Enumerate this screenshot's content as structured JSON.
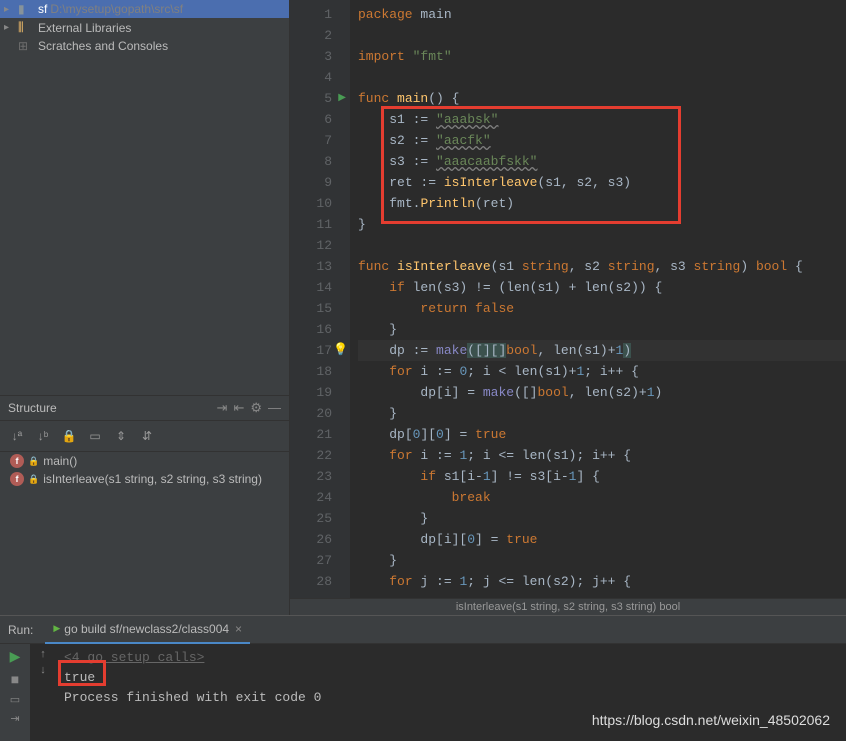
{
  "project": {
    "root_name": "sf",
    "root_path": "D:\\mysetup\\gopath\\src\\sf",
    "external_libs": "External Libraries",
    "scratches": "Scratches and Consoles"
  },
  "structure": {
    "title": "Structure",
    "items": [
      {
        "name": "main()"
      },
      {
        "name": "isInterleave(s1 string, s2 string, s3 string)"
      }
    ]
  },
  "gutter_lines": [
    "1",
    "2",
    "3",
    "4",
    "5",
    "6",
    "7",
    "8",
    "9",
    "10",
    "11",
    "12",
    "13",
    "14",
    "15",
    "16",
    "17",
    "18",
    "19",
    "20",
    "21",
    "22",
    "23",
    "24",
    "25",
    "26",
    "27",
    "28"
  ],
  "breadcrumb": "isInterleave(s1 string, s2 string, s3 string) bool",
  "code": {
    "l1_kw": "package",
    "l1_id": "main",
    "l3_kw": "import",
    "l3_str": "\"fmt\"",
    "l5_kw": "func",
    "l5_fn": "main",
    "l5_rest": "() {",
    "l6_v": "s1",
    "l6_op": " := ",
    "l6_str": "\"aaabsk\"",
    "l7_v": "s2",
    "l7_op": " := ",
    "l7_str": "\"aacfk\"",
    "l8_v": "s3",
    "l8_op": " := ",
    "l8_str": "\"aaacaabfskk\"",
    "l9_v": "ret",
    "l9_op": " := ",
    "l9_fn": "isInterleave",
    "l9_args": "(s1, s2, s3)",
    "l10_pre": "fmt.",
    "l10_fn": "Println",
    "l10_args": "(ret)",
    "l11": "}",
    "l13_kw": "func",
    "l13_fn": "isInterleave",
    "l13_sig": "(s1 ",
    "l13_t": "string",
    "l13_sig2": ", s2 ",
    "l13_sig3": ", s3 ",
    "l13_sig4": ") ",
    "l13_ret": "bool",
    "l13_end": " {",
    "l14_kw": "if",
    "l14_expr": " len(s3) != (len(s1) + len(s2)) {",
    "l15_kw": "return",
    "l15_v": " false",
    "l16": "}",
    "l17_v": "dp",
    "l17_op": " := ",
    "l17_fn": "make",
    "l17_args1": "([][]",
    "l17_bool": "bool",
    "l17_args2": ", len(s1)+",
    "l17_num": "1",
    "l17_args3": ")",
    "l18_kw": "for",
    "l18_a": " i := ",
    "l18_n0": "0",
    "l18_b": "; i < len(s1)+",
    "l18_n1": "1",
    "l18_c": "; i++ {",
    "l19_a": "dp[i] = ",
    "l19_fn": "make",
    "l19_b": "([]",
    "l19_bool": "bool",
    "l19_c": ", len(s2)+",
    "l19_n": "1",
    "l19_d": ")",
    "l20": "}",
    "l21_a": "dp[",
    "l21_n0": "0",
    "l21_b": "][",
    "l21_n1": "0",
    "l21_c": "] = ",
    "l21_v": "true",
    "l22_kw": "for",
    "l22_a": " i := ",
    "l22_n": "1",
    "l22_b": "; i <= len(s1); i++ {",
    "l23_kw": "if",
    "l23_a": " s1[i-",
    "l23_n1": "1",
    "l23_b": "] != s3[i-",
    "l23_n2": "1",
    "l23_c": "] {",
    "l24_kw": "break",
    "l25": "}",
    "l26_a": "dp[i][",
    "l26_n": "0",
    "l26_b": "] = ",
    "l26_v": "true",
    "l27": "}",
    "l28_kw": "for",
    "l28_a": " j := ",
    "l28_n": "1",
    "l28_b": "; j <= len(s2); j++ {"
  },
  "run": {
    "label": "Run:",
    "tab": "go build sf/newclass2/class004",
    "setup": "<4 go setup calls>",
    "output": "true",
    "finished": "Process finished with exit code 0"
  },
  "watermark": "https://blog.csdn.net/weixin_48502062"
}
